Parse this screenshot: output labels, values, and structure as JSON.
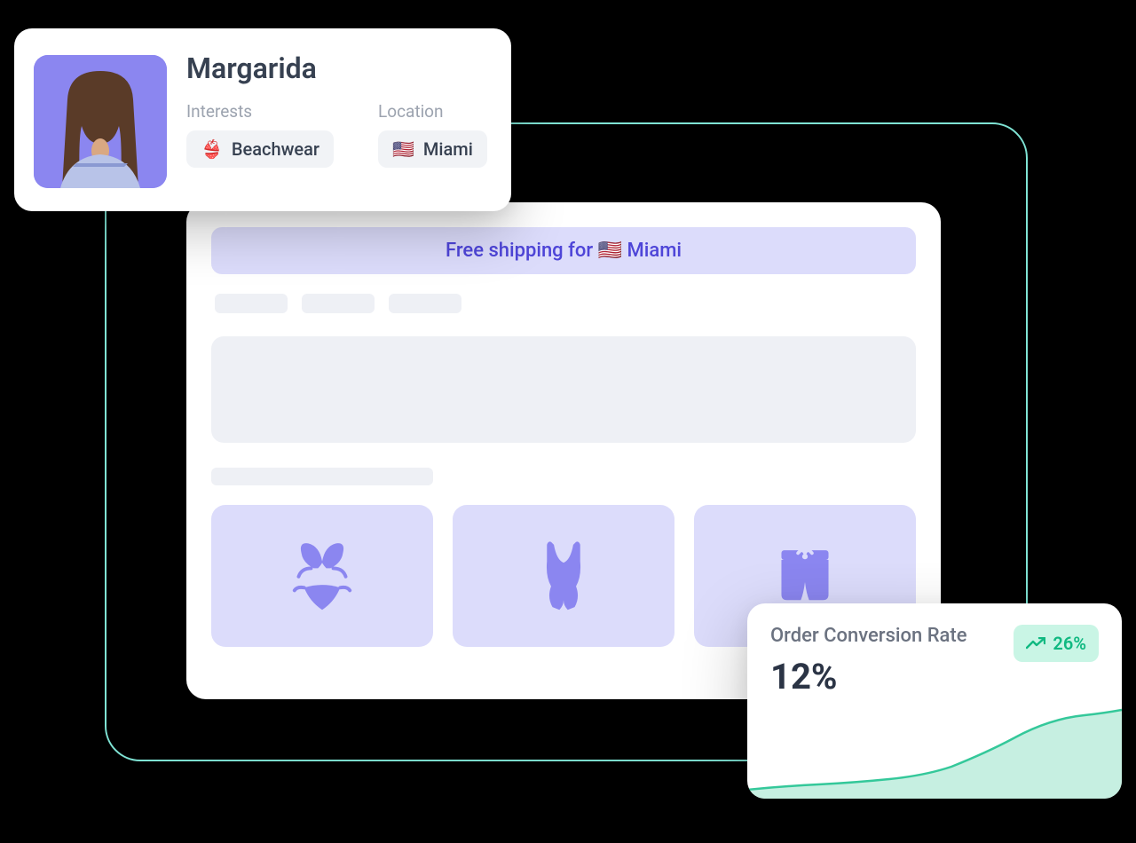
{
  "profile": {
    "name": "Margarida",
    "interests_label": "Interests",
    "interest_icon": "👙",
    "interest_value": "Beachwear",
    "location_label": "Location",
    "location_icon": "🇺🇸",
    "location_value": "Miami"
  },
  "store": {
    "banner_prefix": "Free shipping for ",
    "banner_flag": "🇺🇸",
    "banner_location": " Miami",
    "products": [
      {
        "icon": "bikini"
      },
      {
        "icon": "one-piece"
      },
      {
        "icon": "swim-trunks"
      }
    ]
  },
  "metric": {
    "title": "Order Conversion Rate",
    "value": "12%",
    "change": "26%"
  }
}
